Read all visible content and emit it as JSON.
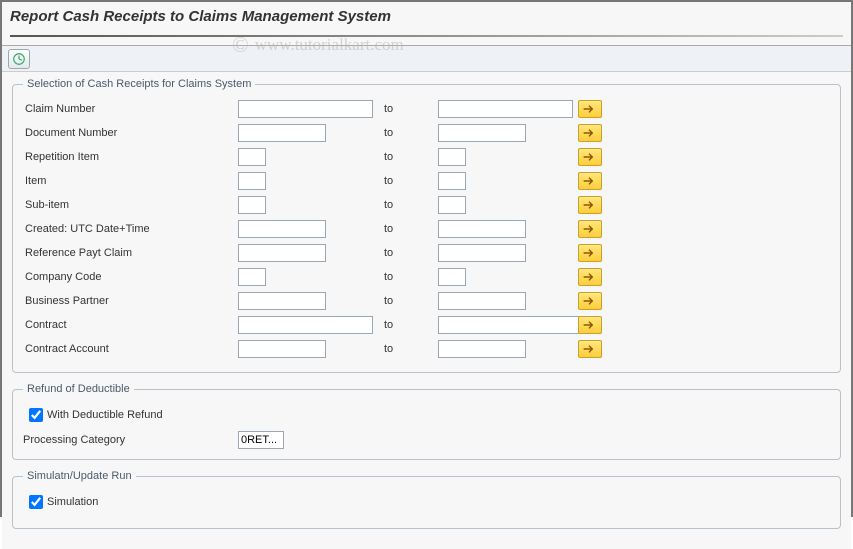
{
  "title": "Report Cash Receipts to Claims Management System",
  "watermark": "www.tutorialkart.com",
  "toolbar": {
    "execute_title": "Execute"
  },
  "labels": {
    "to": "to"
  },
  "group1": {
    "legend": "Selection of Cash Receipts for Claims System",
    "rows": {
      "claim": {
        "label": "Claim Number",
        "from": "",
        "to": ""
      },
      "doc": {
        "label": "Document Number",
        "from": "",
        "to": ""
      },
      "rep": {
        "label": "Repetition Item",
        "from": "",
        "to": ""
      },
      "item": {
        "label": "Item",
        "from": "",
        "to": ""
      },
      "subitem": {
        "label": "Sub-item",
        "from": "",
        "to": ""
      },
      "created": {
        "label": "Created: UTC Date+Time",
        "from": "",
        "to": ""
      },
      "refpayt": {
        "label": "Reference Payt Claim",
        "from": "",
        "to": ""
      },
      "company": {
        "label": "Company Code",
        "from": "",
        "to": ""
      },
      "bp": {
        "label": "Business Partner",
        "from": "",
        "to": ""
      },
      "contract": {
        "label": "Contract",
        "from": "",
        "to": ""
      },
      "contacct": {
        "label": "Contract Account",
        "from": "",
        "to": ""
      }
    }
  },
  "group2": {
    "legend": "Refund of Deductible",
    "with_refund_label": "With Deductible Refund",
    "with_refund_checked": true,
    "proc_cat_label": "Processing Category",
    "proc_cat_value": "0RET..."
  },
  "group3": {
    "legend": "Simulatn/Update Run",
    "simulation_label": "Simulation",
    "simulation_checked": true
  }
}
